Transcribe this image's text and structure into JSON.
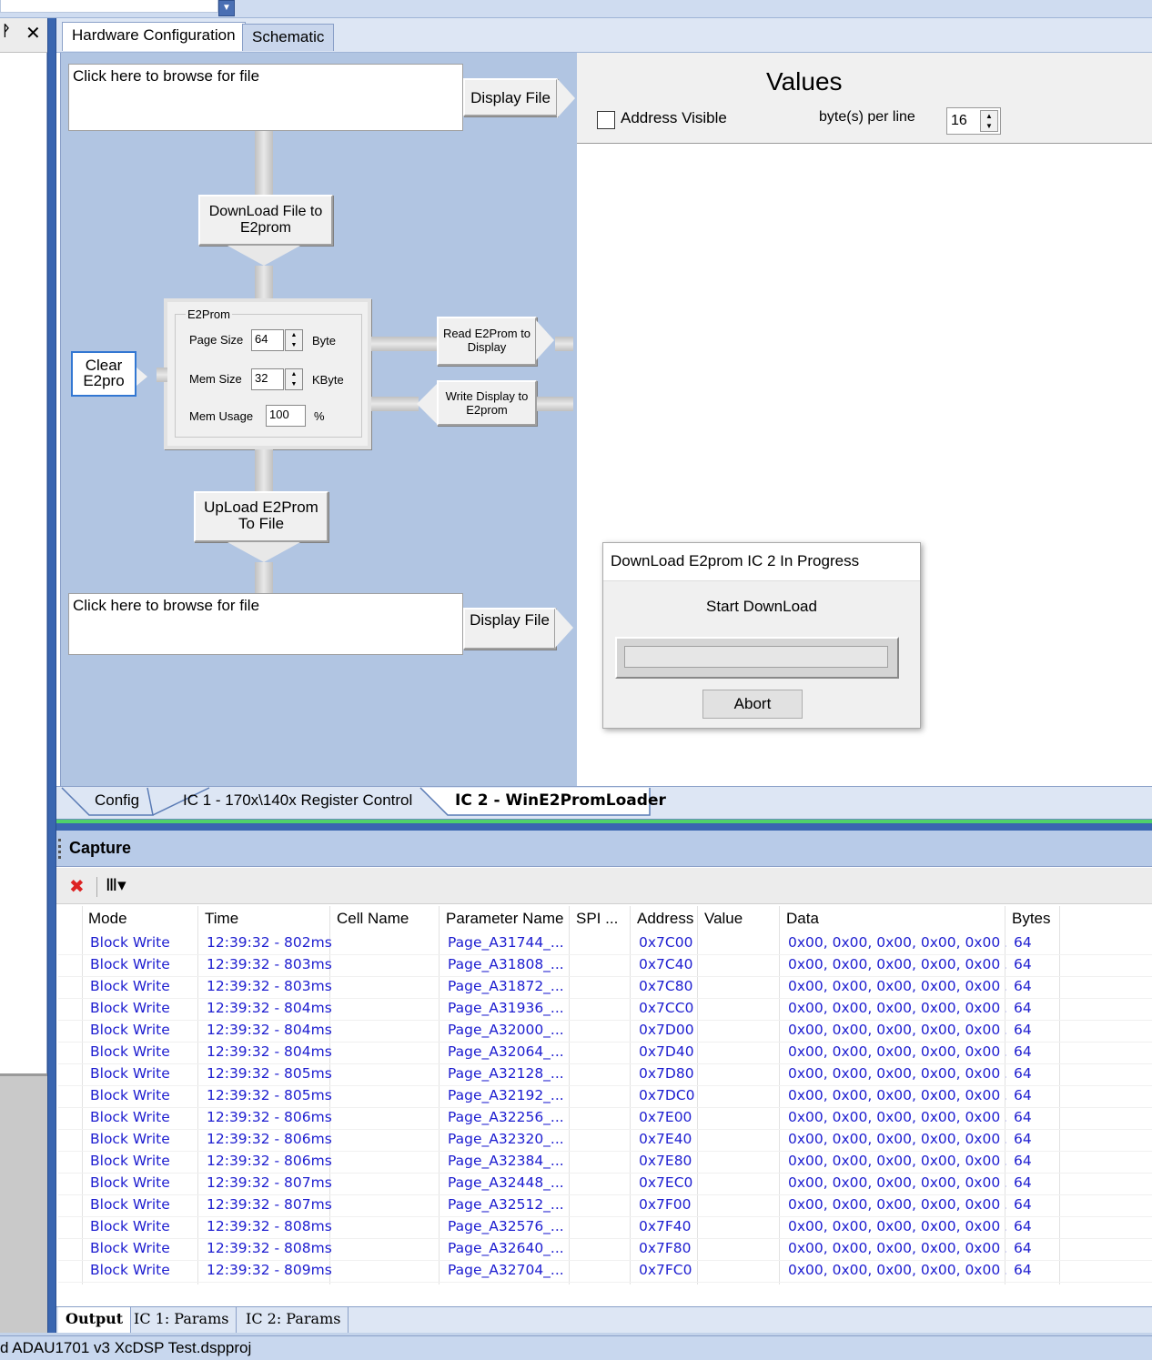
{
  "window": {
    "status_text": "d ADAU1701 v3 XcDSP Test.dspproj"
  },
  "left_panel": {
    "pin_icon": "pin-icon",
    "close_icon": "close-icon",
    "pin_glyph": "ᚹ",
    "close_glyph": "✕"
  },
  "doc_tabs": [
    {
      "label": "Hardware Configuration"
    },
    {
      "label": "Schematic"
    }
  ],
  "loader": {
    "browse_top": "Click here to browse for file",
    "display_file_top": "Display File",
    "download_btn": "DownLoad File to E2prom",
    "e2prom_group": "E2Prom",
    "page_size_label": "Page Size",
    "page_size_value": "64",
    "page_size_unit": "Byte",
    "mem_size_label": "Mem Size",
    "mem_size_value": "32",
    "mem_size_unit": "KByte",
    "mem_usage_label": "Mem Usage",
    "mem_usage_value": "100",
    "mem_usage_unit": "%",
    "clear_btn": "Clear E2pro",
    "read_btn": "Read E2Prom to Display",
    "write_btn": "Write Display to E2prom",
    "upload_btn": "UpLoad E2Prom To File",
    "browse_bottom": "Click here to browse for file",
    "display_file_bottom": "Display File"
  },
  "values_panel": {
    "title": "Values",
    "address_visible_label": "Address Visible",
    "address_visible_checked": false,
    "bytes_per_line_label": "byte(s) per line",
    "bytes_per_line_value": "16"
  },
  "modal": {
    "title": "DownLoad E2prom IC 2 In Progress",
    "subtitle": "Start DownLoad",
    "progress": 0,
    "abort_label": "Abort"
  },
  "bottom_tabs": [
    {
      "label": "Config",
      "active": false
    },
    {
      "label": "IC 1 - 170x\\140x Register Control",
      "active": false
    },
    {
      "label": "IC 2 - WinE2PromLoader",
      "active": true
    }
  ],
  "capture": {
    "title": "Capture",
    "clear_icon": "clear-capture-icon",
    "columns_icon": "columns-icon",
    "columns": [
      "Mode",
      "Time",
      "Cell Name",
      "Parameter Name",
      "SPI ...",
      "Address",
      "Value",
      "Data",
      "Bytes"
    ],
    "rows": [
      [
        "Block Write",
        "12:39:32 - 802ms",
        "",
        "Page_A31744_...",
        "",
        "0x7C00",
        "",
        "0x00, 0x00, 0x00, 0x00, 0x00 ...",
        "64"
      ],
      [
        "Block Write",
        "12:39:32 - 803ms",
        "",
        "Page_A31808_...",
        "",
        "0x7C40",
        "",
        "0x00, 0x00, 0x00, 0x00, 0x00 ...",
        "64"
      ],
      [
        "Block Write",
        "12:39:32 - 803ms",
        "",
        "Page_A31872_...",
        "",
        "0x7C80",
        "",
        "0x00, 0x00, 0x00, 0x00, 0x00 ...",
        "64"
      ],
      [
        "Block Write",
        "12:39:32 - 804ms",
        "",
        "Page_A31936_...",
        "",
        "0x7CC0",
        "",
        "0x00, 0x00, 0x00, 0x00, 0x00 ...",
        "64"
      ],
      [
        "Block Write",
        "12:39:32 - 804ms",
        "",
        "Page_A32000_...",
        "",
        "0x7D00",
        "",
        "0x00, 0x00, 0x00, 0x00, 0x00 ...",
        "64"
      ],
      [
        "Block Write",
        "12:39:32 - 804ms",
        "",
        "Page_A32064_...",
        "",
        "0x7D40",
        "",
        "0x00, 0x00, 0x00, 0x00, 0x00 ...",
        "64"
      ],
      [
        "Block Write",
        "12:39:32 - 805ms",
        "",
        "Page_A32128_...",
        "",
        "0x7D80",
        "",
        "0x00, 0x00, 0x00, 0x00, 0x00 ...",
        "64"
      ],
      [
        "Block Write",
        "12:39:32 - 805ms",
        "",
        "Page_A32192_...",
        "",
        "0x7DC0",
        "",
        "0x00, 0x00, 0x00, 0x00, 0x00 ...",
        "64"
      ],
      [
        "Block Write",
        "12:39:32 - 806ms",
        "",
        "Page_A32256_...",
        "",
        "0x7E00",
        "",
        "0x00, 0x00, 0x00, 0x00, 0x00 ...",
        "64"
      ],
      [
        "Block Write",
        "12:39:32 - 806ms",
        "",
        "Page_A32320_...",
        "",
        "0x7E40",
        "",
        "0x00, 0x00, 0x00, 0x00, 0x00 ...",
        "64"
      ],
      [
        "Block Write",
        "12:39:32 - 806ms",
        "",
        "Page_A32384_...",
        "",
        "0x7E80",
        "",
        "0x00, 0x00, 0x00, 0x00, 0x00 ...",
        "64"
      ],
      [
        "Block Write",
        "12:39:32 - 807ms",
        "",
        "Page_A32448_...",
        "",
        "0x7EC0",
        "",
        "0x00, 0x00, 0x00, 0x00, 0x00 ...",
        "64"
      ],
      [
        "Block Write",
        "12:39:32 - 807ms",
        "",
        "Page_A32512_...",
        "",
        "0x7F00",
        "",
        "0x00, 0x00, 0x00, 0x00, 0x00 ...",
        "64"
      ],
      [
        "Block Write",
        "12:39:32 - 808ms",
        "",
        "Page_A32576_...",
        "",
        "0x7F40",
        "",
        "0x00, 0x00, 0x00, 0x00, 0x00 ...",
        "64"
      ],
      [
        "Block Write",
        "12:39:32 - 808ms",
        "",
        "Page_A32640_...",
        "",
        "0x7F80",
        "",
        "0x00, 0x00, 0x00, 0x00, 0x00 ...",
        "64"
      ],
      [
        "Block Write",
        "12:39:32 - 809ms",
        "",
        "Page_A32704_...",
        "",
        "0x7FC0",
        "",
        "0x00, 0x00, 0x00, 0x00, 0x00 ...",
        "64"
      ]
    ]
  },
  "output_tabs": [
    {
      "label": "Output",
      "active": true
    },
    {
      "label": "IC 1: Params",
      "active": false
    },
    {
      "label": "IC 2: Params",
      "active": false
    }
  ]
}
